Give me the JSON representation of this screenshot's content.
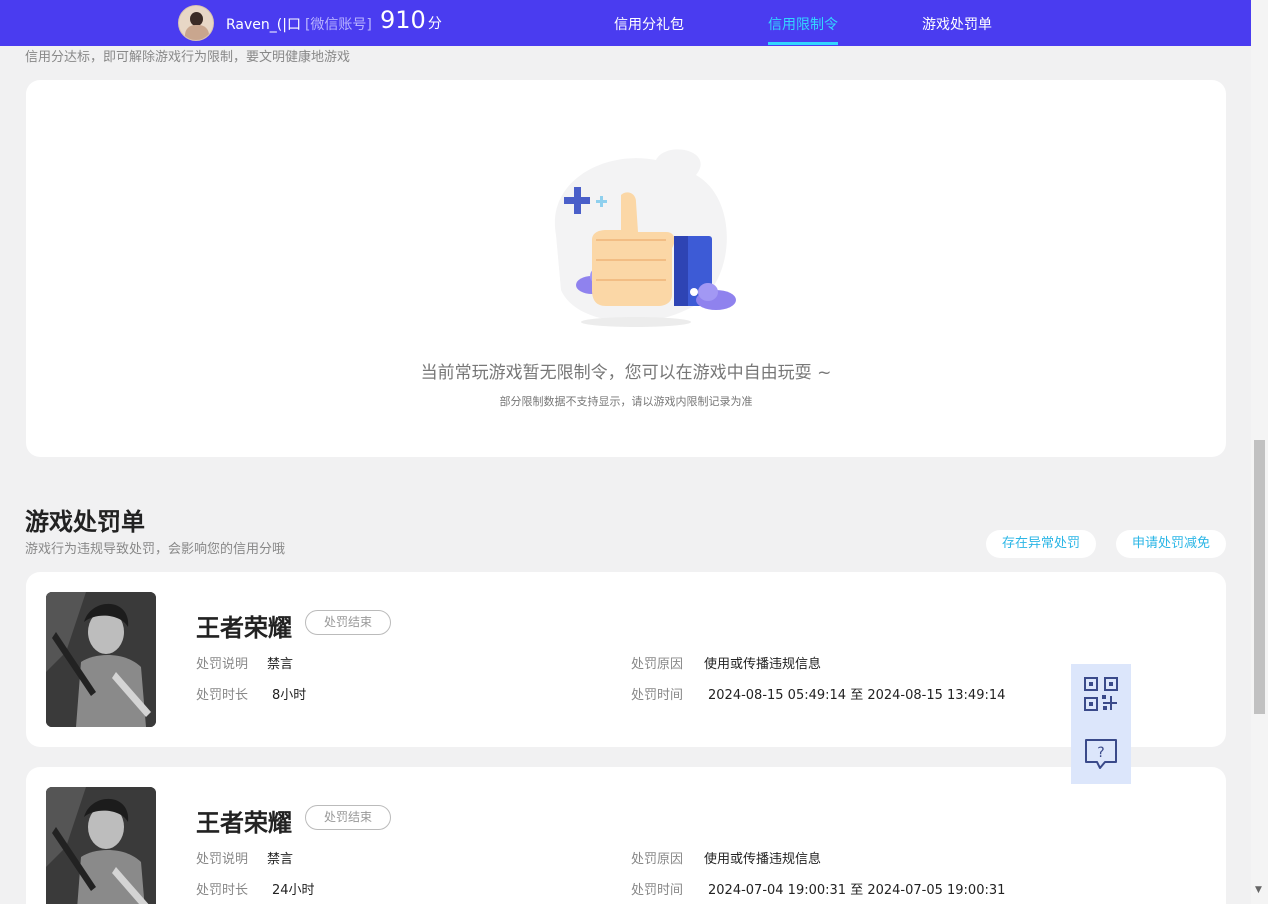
{
  "header": {
    "username": "Raven_(|口",
    "account_tag": "[微信账号]",
    "score": "910",
    "score_unit": "分",
    "nav": [
      "信用分礼包",
      "信用限制令",
      "游戏处罚单"
    ],
    "active_nav": "信用限制令"
  },
  "restriction": {
    "subtitle": "信用分达标，即可解除游戏行为限制，要文明健康地游戏",
    "empty_title": "当前常玩游戏暂无限制令，您可以在游戏中自由玩耍 ~",
    "empty_sub": "部分限制数据不支持显示，请以游戏内限制记录为准"
  },
  "penalty": {
    "title": "游戏处罚单",
    "subtitle": "游戏行为违规导致处罚，会影响您的信用分哦",
    "btn_abnormal": "存在异常处罚",
    "btn_reduce": "申请处罚减免",
    "labels": {
      "desc": "处罚说明",
      "duration": "处罚时长",
      "reason": "处罚原因",
      "time": "处罚时间"
    },
    "records": [
      {
        "game": "王者荣耀",
        "status": "处罚结束",
        "desc": "禁言",
        "duration": "8小时",
        "reason": "使用或传播违规信息",
        "time": "2024-08-15 05:49:14 至 2024-08-15 13:49:14"
      },
      {
        "game": "王者荣耀",
        "status": "处罚结束",
        "desc": "禁言",
        "duration": "24小时",
        "reason": "使用或传播违规信息",
        "time": "2024-07-04 19:00:31 至 2024-07-05 19:00:31"
      }
    ]
  },
  "colors": {
    "header_bg": "#4a3cf0",
    "active_nav": "#33d6ff",
    "pill_text": "#2bb6e6",
    "float_bg": "#dce6fb"
  },
  "icons": [
    "qr-code-icon",
    "help-chat-icon",
    "thumbs-up-illustration"
  ]
}
